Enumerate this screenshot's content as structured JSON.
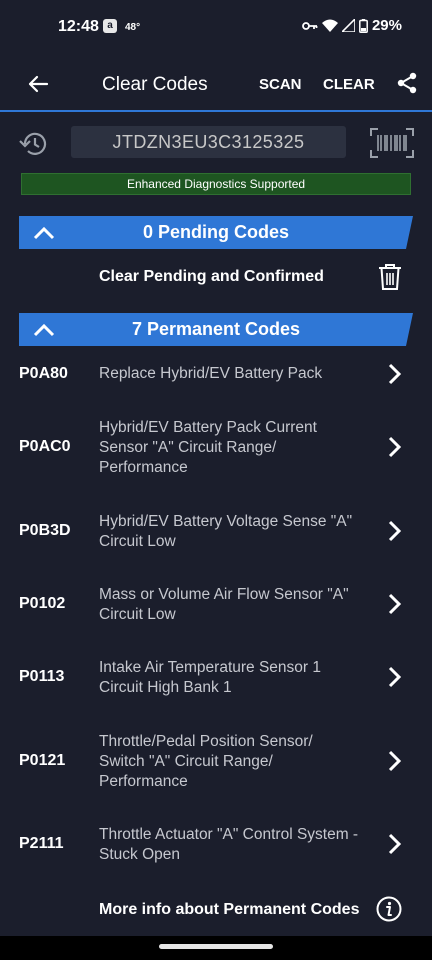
{
  "status_bar": {
    "time": "12:48",
    "app_icon": "a",
    "temperature": "48°",
    "battery": "29%"
  },
  "app_bar": {
    "title": "Clear Codes",
    "scan_label": "SCAN",
    "clear_label": "CLEAR"
  },
  "vin": {
    "value": "JTDZN3EU3C3125325"
  },
  "banner": {
    "text": "Enhanced Diagnostics Supported"
  },
  "pending": {
    "header": "0 Pending Codes",
    "action": "Clear Pending and Confirmed"
  },
  "permanent": {
    "header": "7 Permanent Codes",
    "codes": [
      {
        "code": "P0A80",
        "lines": [
          "Replace Hybrid/EV Battery Pack"
        ]
      },
      {
        "code": "P0AC0",
        "lines": [
          "Hybrid/EV Battery Pack Current",
          "Sensor \"A\" Circuit Range/",
          "Performance"
        ]
      },
      {
        "code": "P0B3D",
        "lines": [
          "Hybrid/EV Battery Voltage Sense \"A\"",
          "Circuit Low"
        ]
      },
      {
        "code": "P0102",
        "lines": [
          "Mass or Volume Air Flow Sensor \"A\"",
          "Circuit Low"
        ]
      },
      {
        "code": "P0113",
        "lines": [
          "Intake Air Temperature Sensor 1",
          "Circuit High Bank 1"
        ]
      },
      {
        "code": "P0121",
        "lines": [
          "Throttle/Pedal Position Sensor/",
          "Switch \"A\" Circuit Range/",
          "Performance"
        ]
      },
      {
        "code": "P2111",
        "lines": [
          "Throttle Actuator \"A\" Control System -",
          "Stuck Open"
        ]
      }
    ],
    "more_info": "More info about Permanent Codes"
  },
  "colors": {
    "background": "#1b1e2c",
    "accent": "#2f77d6",
    "banner": "#1e5521",
    "field": "#2c3140"
  },
  "icons": [
    "back-arrow-icon",
    "share-icon",
    "history-icon",
    "barcode-icon",
    "chevron-up-icon",
    "trash-icon",
    "chevron-right-icon",
    "info-icon"
  ]
}
